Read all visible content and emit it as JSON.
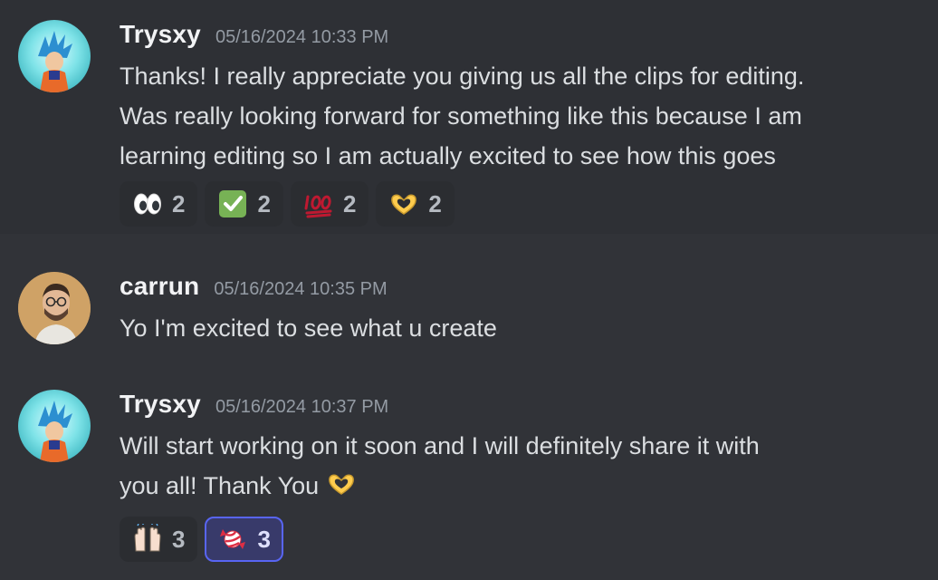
{
  "messages": [
    {
      "author": "Trysxy",
      "timestamp": "05/16/2024 10:33 PM",
      "text": "Thanks! I really appreciate you giving us all the clips for editing.\nWas really looking forward for something like this because I am\nlearning editing so I am actually excited to see how this goes",
      "avatar_icon": "goku-avatar",
      "reactions": [
        {
          "emoji": "eyes-emoji",
          "count": "2",
          "reacted_by_me": false
        },
        {
          "emoji": "check-mark-emoji",
          "count": "2",
          "reacted_by_me": false
        },
        {
          "emoji": "hundred-points-emoji",
          "count": "2",
          "reacted_by_me": false
        },
        {
          "emoji": "heart-hands-emoji",
          "count": "2",
          "reacted_by_me": false
        }
      ]
    },
    {
      "author": "carrun",
      "timestamp": "05/16/2024 10:35 PM",
      "text": "Yo I'm excited to see what u create",
      "avatar_icon": "man-with-glasses-avatar"
    },
    {
      "author": "Trysxy",
      "timestamp": "05/16/2024 10:37 PM",
      "text": "Will start working on it soon and I will definitely share it with\nyou all! Thank You",
      "inline_emoji": "heart-hands-emoji",
      "avatar_icon": "goku-avatar",
      "reactions": [
        {
          "emoji": "raising-hands-emoji",
          "count": "3",
          "reacted_by_me": false
        },
        {
          "emoji": "candy-emoji",
          "count": "3",
          "reacted_by_me": true
        }
      ]
    }
  ],
  "colors": {
    "background": "#313338",
    "hover_background": "#2e3035",
    "username": "#f2f3f5",
    "timestamp": "#949ba4",
    "text": "#dbdee1",
    "reaction_bg": "#2b2d31",
    "reaction_me_bg": "#383a6a",
    "reaction_me_border": "#5865f2"
  }
}
